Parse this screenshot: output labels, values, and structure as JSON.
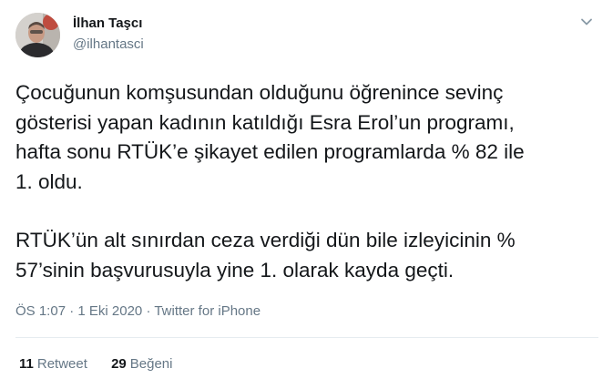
{
  "author": {
    "display_name": "İlhan Taşcı",
    "handle": "@ilhantasci"
  },
  "tweet": {
    "paragraph_1": "Çocuğunun komşusundan olduğunu öğrenince sevinç\ngösterisi yapan kadının katıldığı Esra Erol’un programı,\nhafta sonu RTÜK’e şikayet edilen programlarda % 82 ile\n1. oldu.",
    "paragraph_2": "RTÜK’ün alt sınırdan ceza verdiği dün bile izleyicinin %\n57’sinin başvurusuyla yine 1. olarak kayda geçti."
  },
  "meta": {
    "time": "ÖS 1:07",
    "separator_1": " · ",
    "date": "1 Eki 2020",
    "separator_2": " · ",
    "source": "Twitter for iPhone"
  },
  "stats": {
    "retweets_count": "11",
    "retweets_label": "Retweet",
    "likes_count": "29",
    "likes_label": "Beğeni"
  },
  "icons": {
    "caret": "chevron-down-icon",
    "avatar": "avatar"
  },
  "colors": {
    "text": "#14171a",
    "secondary": "#657786",
    "divider": "#e6ecf0"
  }
}
